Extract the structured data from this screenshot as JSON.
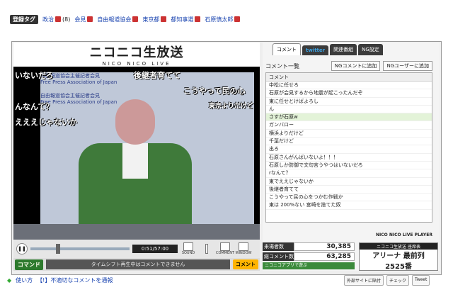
{
  "tag_bar": {
    "label": "登録タグ",
    "tags": [
      {
        "text": "政治",
        "lock": true,
        "count": "(8)"
      },
      {
        "text": "会見",
        "lock": true,
        "count": ""
      },
      {
        "text": "自由報道協会",
        "lock": true,
        "count": ""
      },
      {
        "text": "東京都",
        "lock": true,
        "count": ""
      },
      {
        "text": "都知事選",
        "lock": true,
        "count": ""
      },
      {
        "text": "石原慎太郎",
        "lock": true,
        "count": ""
      }
    ]
  },
  "player": {
    "logo_main": "ニコニコ生放送",
    "logo_sub": "NICO NICO LIVE",
    "backdrop_jp": "自由報道協会主催記者会見",
    "backdrop_en": "Free Press Association of Japan",
    "overlay_comments": [
      "いないだろ",
      "後継者育てて",
      "こうやって民の心",
      "んなんて？",
      "えええじゃないか",
      "東京よりだけど"
    ],
    "time": "0:51/57:00",
    "controls": {
      "sound": "SOUND",
      "comment": "COMMENT",
      "window": "WINDOW"
    },
    "command_label": "コマンド",
    "comment_notice": "タイムシフト再生中はコメントできません",
    "comment_button": "コメント"
  },
  "panel": {
    "tabs": [
      "コメント",
      "twitter",
      "関連番組",
      "NG設定"
    ],
    "list_title": "コメント一覧",
    "ng_comment_btn": "NGコメントに追加",
    "ng_user_btn": "NGユーザーに追加",
    "column_header": "コメント",
    "comments": [
      "中松に任せろ",
      "石原が会見するから地震が起こったんだぞ",
      "東に任せとけばよろし",
      "ん",
      "さすが石原w",
      "ガンバロー",
      "横浜よりだけど",
      "千葉だけど",
      "出ろ",
      "石原さんがんばいないよ！！！",
      "石原しか防御で文句言うやつはいないだろ",
      "rなんて？",
      "東でええじゃないか",
      "後継者育てて",
      "こうやって民の心をつかむ作戦か",
      "東は 200%ない 宮崎を捨てた奴"
    ],
    "highlight_index": 4,
    "brand": "NICO NICO LIVE PLAYER",
    "stats": [
      {
        "label": "来場者数",
        "value": "30,385"
      },
      {
        "label": "総コメント数",
        "value": "63,285"
      }
    ],
    "app_button": "ニコニコアプリで遊ぶ",
    "seat_title": "ニコニコ生放送 座席表",
    "seat_block": "アリーナ 最前列",
    "seat_number": "2525番"
  },
  "footer": {
    "usage": "使い方",
    "report": "【!】不適切なコメントを通報",
    "ext_btn": "外部サイトに貼付",
    "check_btn": "チェック",
    "tweet_btn": "Tweet"
  }
}
